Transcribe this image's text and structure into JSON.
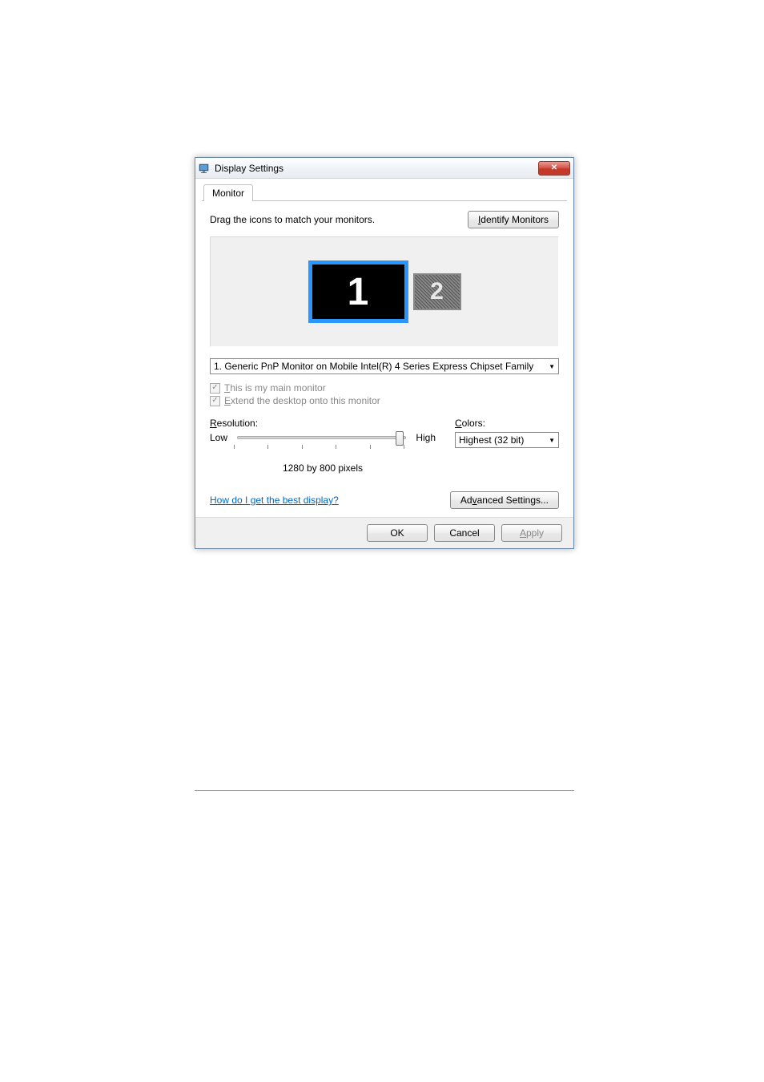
{
  "dialog": {
    "title": "Display Settings",
    "tab": "Monitor",
    "instruction": "Drag the icons to match your monitors.",
    "identify_button": "Identify Monitors",
    "monitors": {
      "primary": "1",
      "secondary": "2"
    },
    "monitor_dropdown": "1. Generic PnP Monitor on Mobile Intel(R) 4 Series Express Chipset Family",
    "checkbox_main": "This is my main monitor",
    "checkbox_extend": "Extend the desktop onto this monitor",
    "resolution": {
      "label": "Resolution:",
      "low": "Low",
      "high": "High",
      "value": "1280 by 800 pixels"
    },
    "colors": {
      "label": "Colors:",
      "value": "Highest (32 bit)"
    },
    "help_link": "How do I get the best display?",
    "advanced_button": "Advanced Settings...",
    "ok_button": "OK",
    "cancel_button": "Cancel",
    "apply_button": "Apply"
  }
}
